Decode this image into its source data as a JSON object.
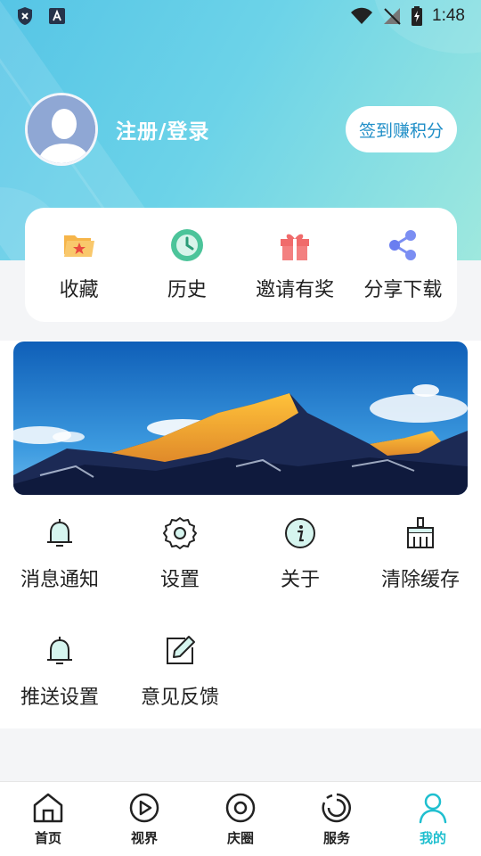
{
  "status_bar": {
    "time": "1:48",
    "icons": [
      "shield-x-icon",
      "app-a-icon",
      "wifi-icon",
      "no-signal-icon",
      "battery-charging-icon"
    ]
  },
  "profile": {
    "login_text": "注册/登录",
    "checkin_label": "签到赚积分"
  },
  "quick_actions": [
    {
      "label": "收藏",
      "icon": "folder-star-icon"
    },
    {
      "label": "历史",
      "icon": "clock-history-icon"
    },
    {
      "label": "邀请有奖",
      "icon": "gift-icon"
    },
    {
      "label": "分享下载",
      "icon": "share-icon"
    }
  ],
  "banner": {
    "image": "snowy-mountain-banner"
  },
  "menu": [
    {
      "label": "消息通知",
      "icon": "bell-icon"
    },
    {
      "label": "设置",
      "icon": "gear-icon"
    },
    {
      "label": "关于",
      "icon": "info-icon"
    },
    {
      "label": "清除缓存",
      "icon": "broom-icon"
    },
    {
      "label": "推送设置",
      "icon": "bell-icon"
    },
    {
      "label": "意见反馈",
      "icon": "edit-icon"
    }
  ],
  "bottom_nav": [
    {
      "label": "首页",
      "icon": "home-icon"
    },
    {
      "label": "视界",
      "icon": "play-icon"
    },
    {
      "label": "庆圈",
      "icon": "circle-target-icon"
    },
    {
      "label": "服务",
      "icon": "service-swirl-icon"
    },
    {
      "label": "我的",
      "icon": "user-icon",
      "active": true
    }
  ],
  "colors": {
    "accent": "#1fbfcf",
    "checkin_text": "#1f8ec7",
    "header_gradient_start": "#56c5e6",
    "header_gradient_end": "#9ee8de"
  }
}
